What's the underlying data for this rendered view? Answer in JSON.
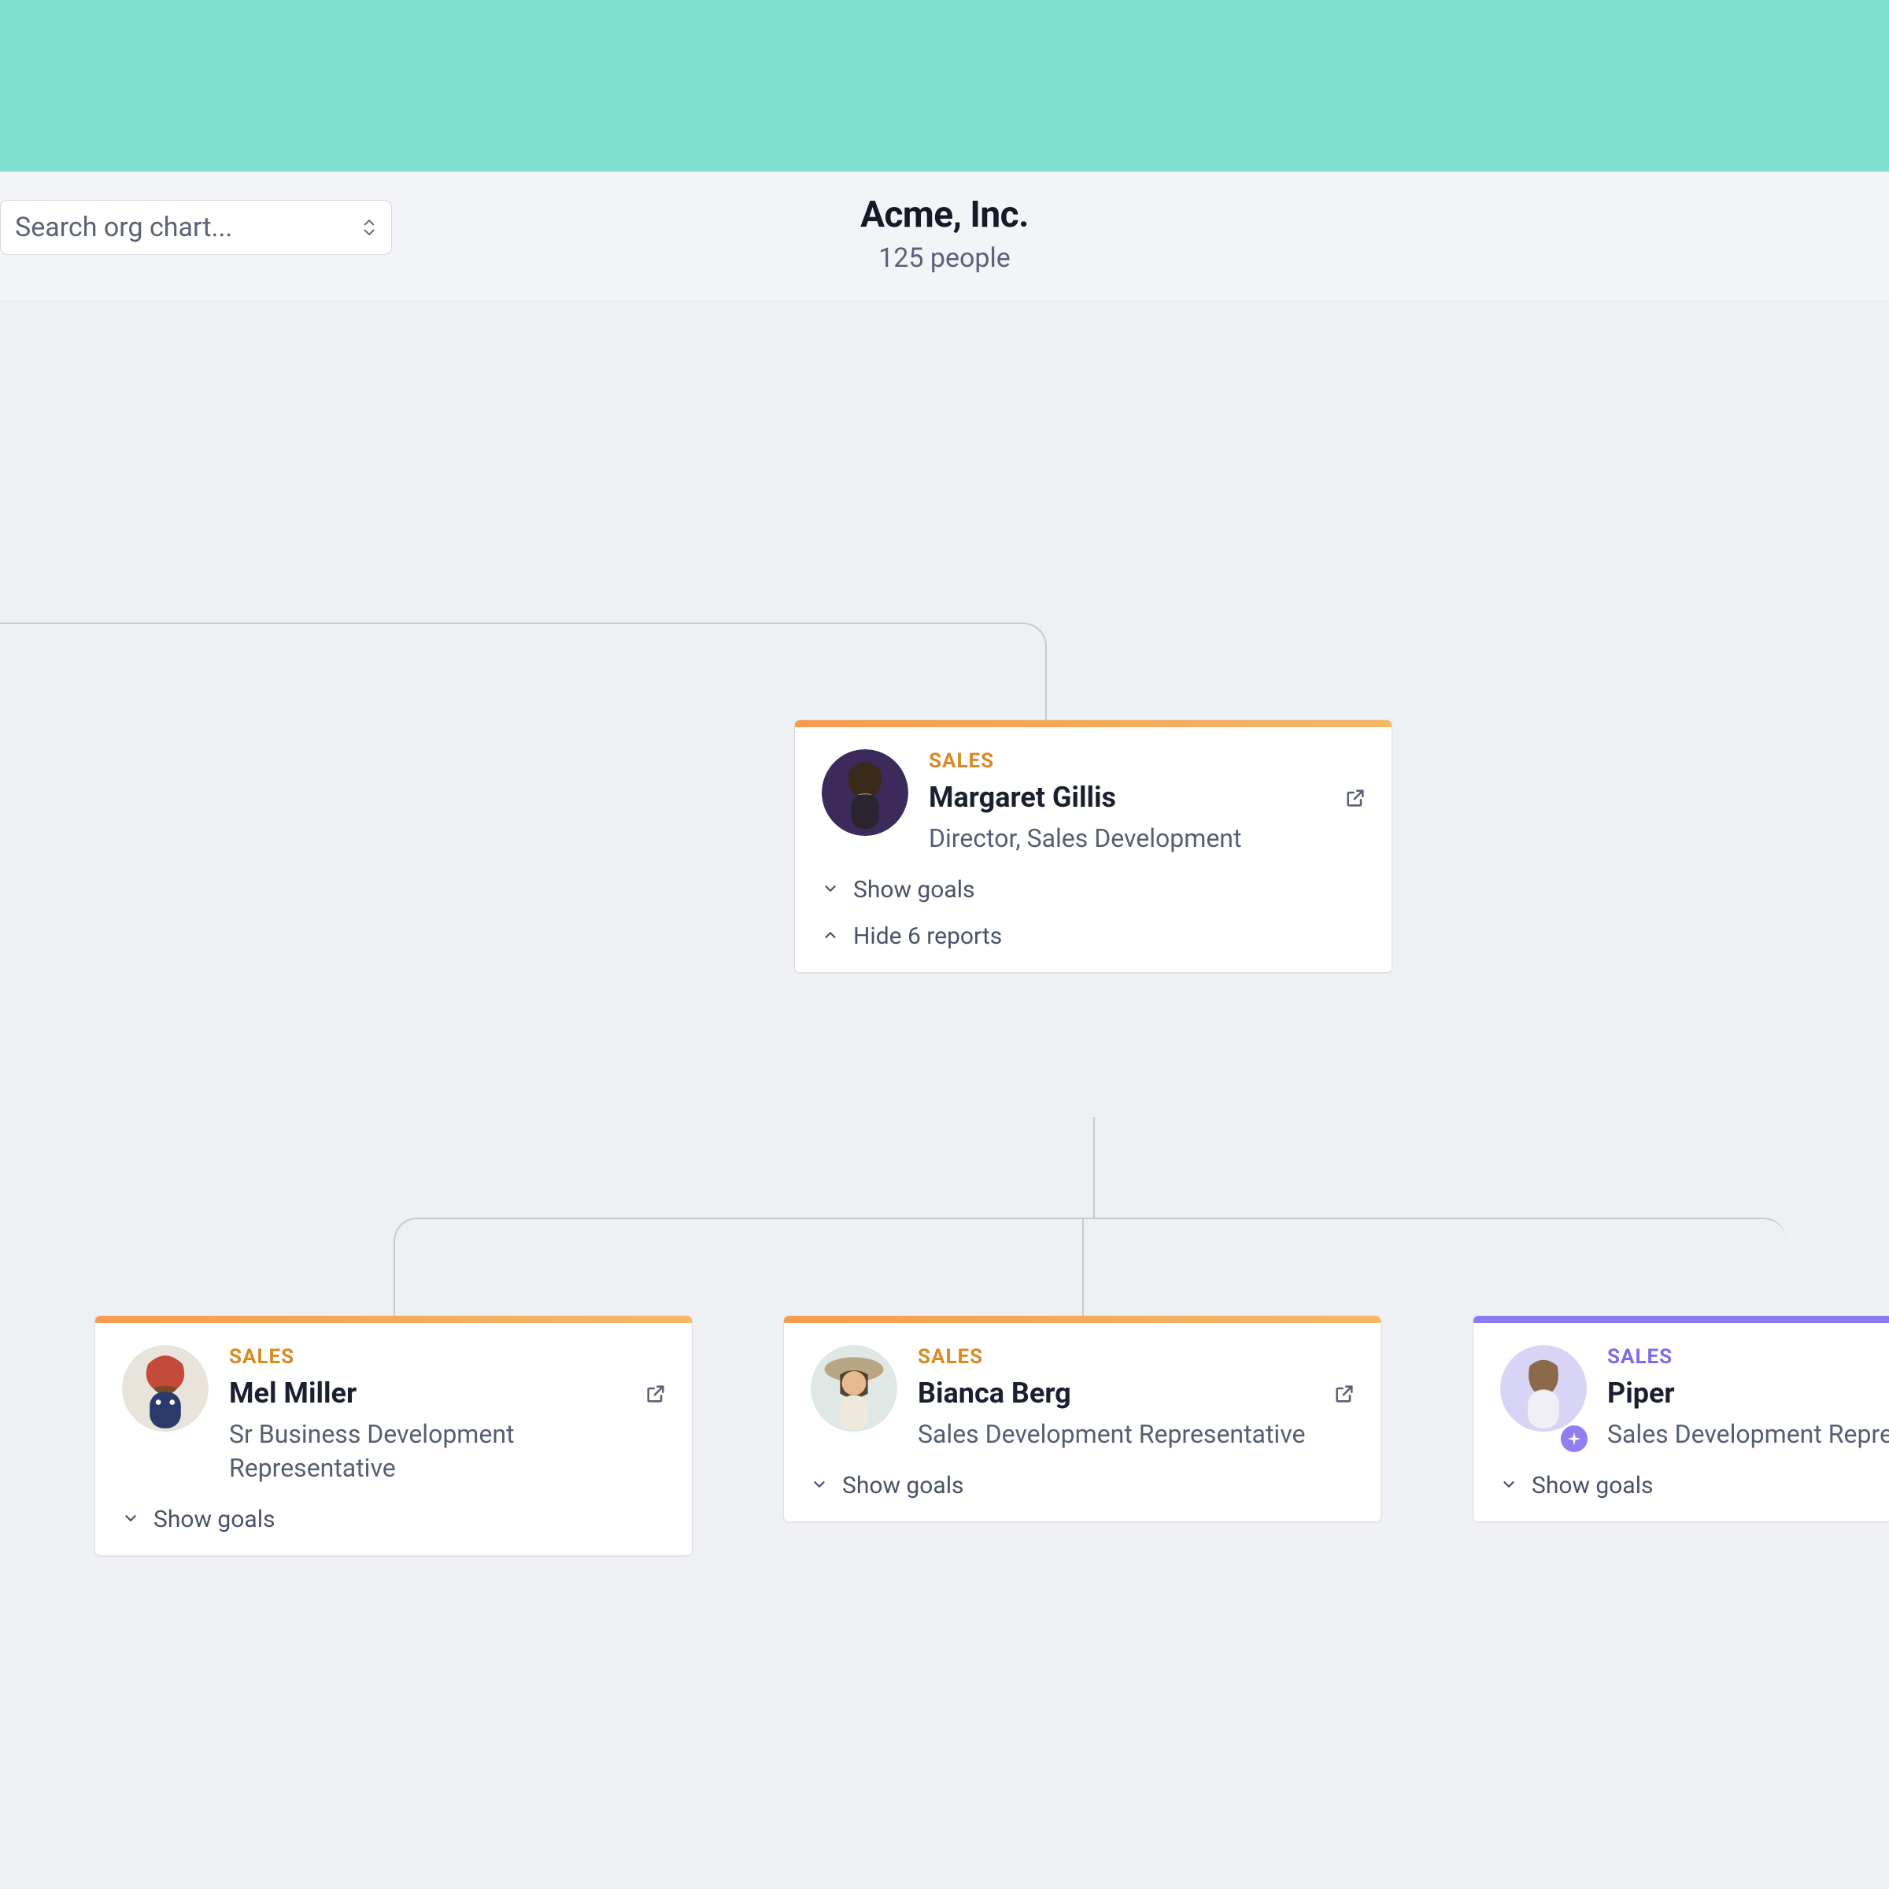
{
  "header": {
    "search_placeholder": "Search org chart...",
    "company": "Acme, Inc.",
    "people_count": "125 people"
  },
  "colors": {
    "banner": "#7fe0cf",
    "sales_accent": "#d88a25",
    "purple_accent": "#8a7cf0"
  },
  "manager": {
    "dept": "SALES",
    "name": "Margaret Gillis",
    "title": "Director, Sales Development",
    "show_goals": "Show goals",
    "reports_toggle": "Hide 6 reports",
    "avatar_bg": "#3b2a5a"
  },
  "reports": [
    {
      "dept": "SALES",
      "name": "Mel Miller",
      "title": "Sr Business Development Representative",
      "show_goals": "Show goals",
      "bar": "orange",
      "avatar_bg": "#c44a3a"
    },
    {
      "dept": "SALES",
      "name": "Bianca Berg",
      "title": "Sales Development Representative",
      "show_goals": "Show goals",
      "bar": "orange",
      "avatar_bg": "#b7a583"
    },
    {
      "dept": "SALES",
      "name": "Piper",
      "title": "Sales Development Representative",
      "show_goals": "Show goals",
      "bar": "purple",
      "avatar_bg": "#d8d4f5",
      "badge": true
    }
  ]
}
